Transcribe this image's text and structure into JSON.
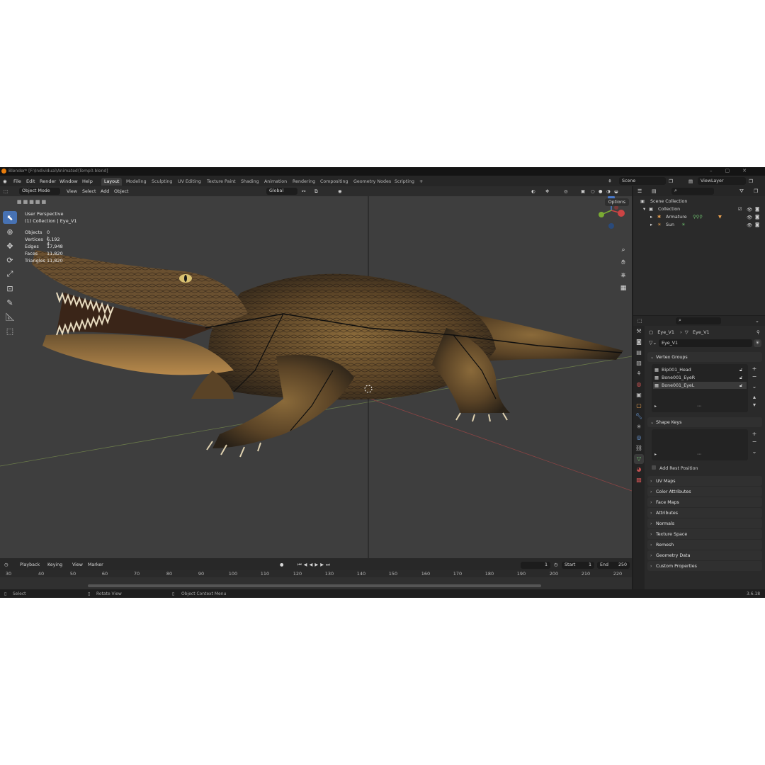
{
  "window": {
    "title": "Blender* [F:\\Individual\\Animated\\Temp0.blend]"
  },
  "menu": [
    "File",
    "Edit",
    "Render",
    "Window",
    "Help"
  ],
  "workspaces": [
    "Layout",
    "Modeling",
    "Sculpting",
    "UV Editing",
    "Texture Paint",
    "Shading",
    "Animation",
    "Rendering",
    "Compositing",
    "Geometry Nodes",
    "Scripting"
  ],
  "scene": {
    "name": "Scene",
    "view_layer": "ViewLayer"
  },
  "viewport": {
    "mode": "Object Mode",
    "menus": [
      "View",
      "Select",
      "Add",
      "Object"
    ],
    "transform_orientation": "Global",
    "options_label": "Options",
    "perspective": "User Perspective",
    "collection_info": "(1) Collection | Eye_V1",
    "stats": [
      {
        "label": "Objects",
        "value": "0 / 4"
      },
      {
        "label": "Vertices",
        "value": "6,192"
      },
      {
        "label": "Edges",
        "value": "17,948"
      },
      {
        "label": "Faces",
        "value": "11,820"
      },
      {
        "label": "Triangles",
        "value": "11,820"
      }
    ]
  },
  "timeline": {
    "menus": [
      "Playback",
      "Keying",
      "View",
      "Marker"
    ],
    "current_frame": "1",
    "start_label": "Start",
    "start": "1",
    "end_label": "End",
    "end": "250",
    "ticks": [
      "30",
      "40",
      "50",
      "60",
      "70",
      "80",
      "90",
      "100",
      "110",
      "120",
      "130",
      "140",
      "150",
      "160",
      "170",
      "180",
      "190",
      "200",
      "210",
      "220"
    ]
  },
  "statusbar": {
    "select": "Select",
    "rotate": "Rotate View",
    "context": "Object Context Menu",
    "version": "3.6.18"
  },
  "outliner": {
    "scene_collection": "Scene Collection",
    "collection": "Collection",
    "items": [
      "Armature",
      "Sun"
    ]
  },
  "properties": {
    "breadcrumb_object": "Eye_V1",
    "breadcrumb_data": "Eye_V1",
    "data_name": "Eye_V1",
    "vertex_groups_title": "Vertex Groups",
    "vertex_groups": [
      "Bip001_Head",
      "Bone001_EyeR",
      "Bone001_EyeL"
    ],
    "shape_keys_title": "Shape Keys",
    "add_rest_position": "Add Rest Position",
    "panels": [
      "UV Maps",
      "Color Attributes",
      "Face Maps",
      "Attributes",
      "Normals",
      "Texture Space",
      "Remesh",
      "Geometry Data",
      "Custom Properties"
    ]
  }
}
